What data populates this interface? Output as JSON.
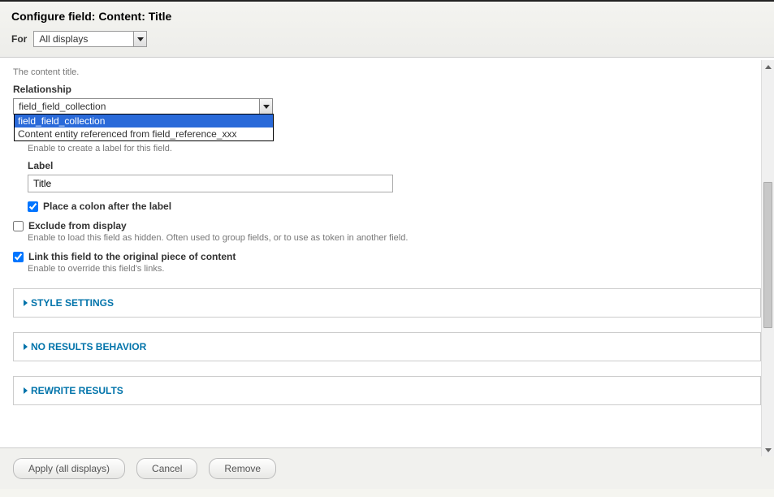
{
  "header": {
    "title": "Configure field: Content: Title",
    "for_label": "For",
    "for_value": "All displays"
  },
  "content": {
    "desc": "The content title.",
    "relationship_label": "Relationship",
    "relationship_value": "field_field_collection",
    "relationship_options": [
      "field_field_collection",
      "Content entity referenced from field_reference_xxx"
    ],
    "create_label_help": "Enable to create a label for this field.",
    "label_label": "Label",
    "label_value": "Title",
    "colon_label": "Place a colon after the label",
    "colon_checked": true,
    "exclude_label": "Exclude from display",
    "exclude_checked": false,
    "exclude_help": "Enable to load this field as hidden. Often used to group fields, or to use as token in another field.",
    "link_label": "Link this field to the original piece of content",
    "link_checked": true,
    "link_help": "Enable to override this field's links.",
    "fieldsets": {
      "style": "STYLE SETTINGS",
      "no_results": "NO RESULTS BEHAVIOR",
      "rewrite": "REWRITE RESULTS"
    }
  },
  "footer": {
    "apply": "Apply (all displays)",
    "cancel": "Cancel",
    "remove": "Remove"
  }
}
